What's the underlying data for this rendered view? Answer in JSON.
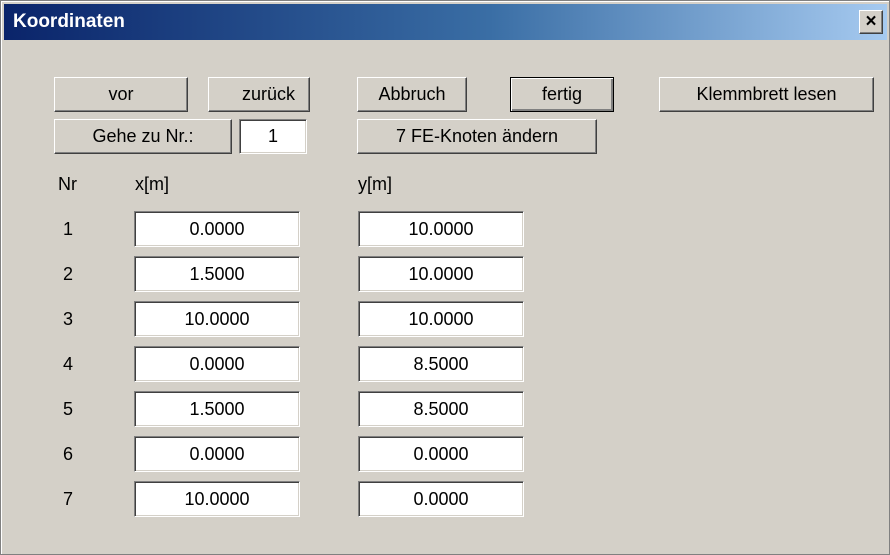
{
  "window": {
    "title": "Koordinaten",
    "close_label": "×"
  },
  "toolbar": {
    "vor_label": "vor",
    "zurueck_label": "zurück",
    "abbruch_label": "Abbruch",
    "fertig_label": "fertig",
    "klemmbrett_label": "Klemmbrett lesen",
    "gehe_zu_label": "Gehe zu Nr.:",
    "gehe_zu_value": "1",
    "fe_knoten_label": "7 FE-Knoten ändern"
  },
  "table": {
    "headers": {
      "nr": "Nr",
      "x": "x[m]",
      "y": "y[m]"
    },
    "rows": [
      {
        "nr": "1",
        "x": "0.0000",
        "y": "10.0000"
      },
      {
        "nr": "2",
        "x": "1.5000",
        "y": "10.0000"
      },
      {
        "nr": "3",
        "x": "10.0000",
        "y": "10.0000"
      },
      {
        "nr": "4",
        "x": "0.0000",
        "y": "8.5000"
      },
      {
        "nr": "5",
        "x": "1.5000",
        "y": "8.5000"
      },
      {
        "nr": "6",
        "x": "0.0000",
        "y": "0.0000"
      },
      {
        "nr": "7",
        "x": "10.0000",
        "y": "0.0000"
      }
    ]
  }
}
